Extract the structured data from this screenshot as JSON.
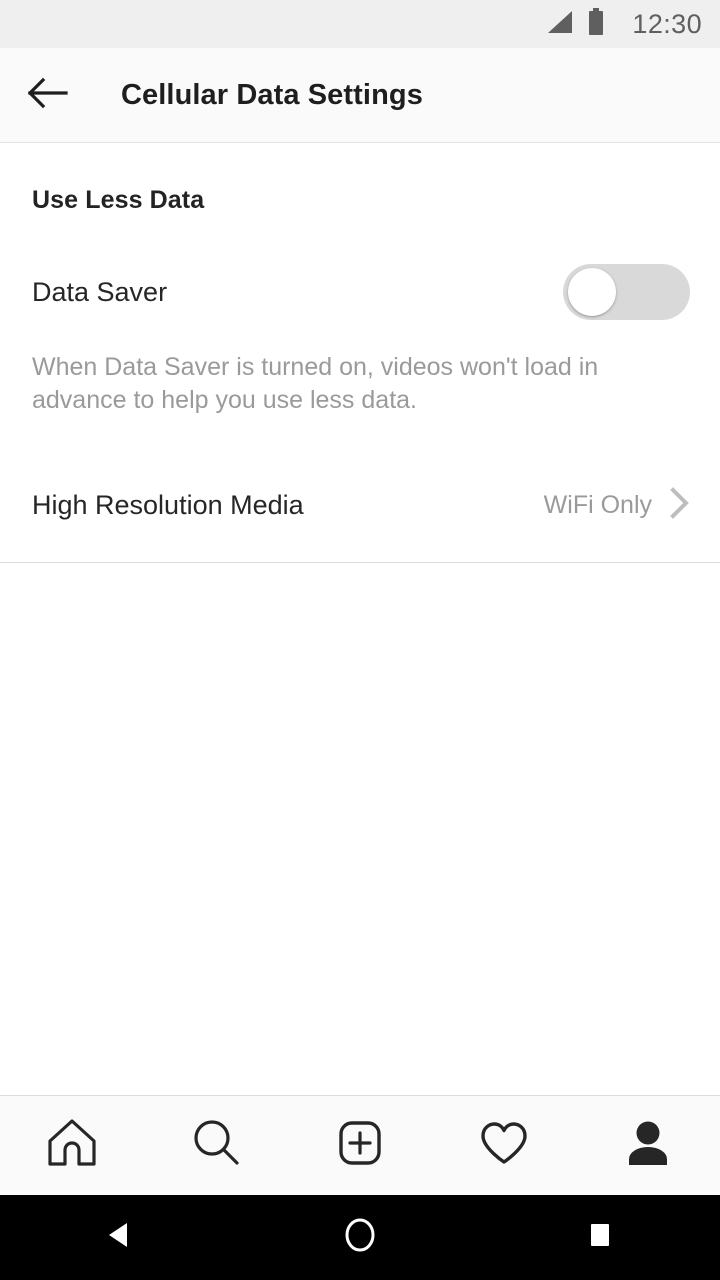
{
  "status_bar": {
    "time": "12:30",
    "signal_icon": "cellular-signal-icon",
    "battery_icon": "battery-icon",
    "background_color": "#efefef",
    "icon_color": "#5f5f5f"
  },
  "header": {
    "back_icon": "arrow-left-icon",
    "title": "Cellular Data Settings",
    "background_color": "#fafafa"
  },
  "main": {
    "section_title": "Use Less Data",
    "data_saver": {
      "label": "Data Saver",
      "toggle_state": "off",
      "track_color": "#d9d9d9",
      "knob_color": "#ffffff"
    },
    "description": "When Data Saver is turned on, videos won't load in advance to help you use less data.",
    "high_res_media": {
      "label": "High Resolution Media",
      "value": "WiFi Only",
      "chevron_icon": "chevron-right-icon",
      "chevron_color": "#bdbdbd"
    }
  },
  "tab_bar": {
    "items": [
      {
        "name": "home",
        "icon": "home-icon",
        "active": false
      },
      {
        "name": "search",
        "icon": "search-icon",
        "active": false
      },
      {
        "name": "create",
        "icon": "plus-square-icon",
        "active": false
      },
      {
        "name": "activity",
        "icon": "heart-icon",
        "active": false
      },
      {
        "name": "profile",
        "icon": "person-filled-icon",
        "active": true
      }
    ],
    "icon_color": "#262626",
    "background_color": "#fafafa"
  },
  "system_nav": {
    "back_icon": "triangle-back-icon",
    "home_icon": "circle-home-icon",
    "recents_icon": "square-recents-icon",
    "background_color": "#000000",
    "icon_color": "#ffffff"
  }
}
